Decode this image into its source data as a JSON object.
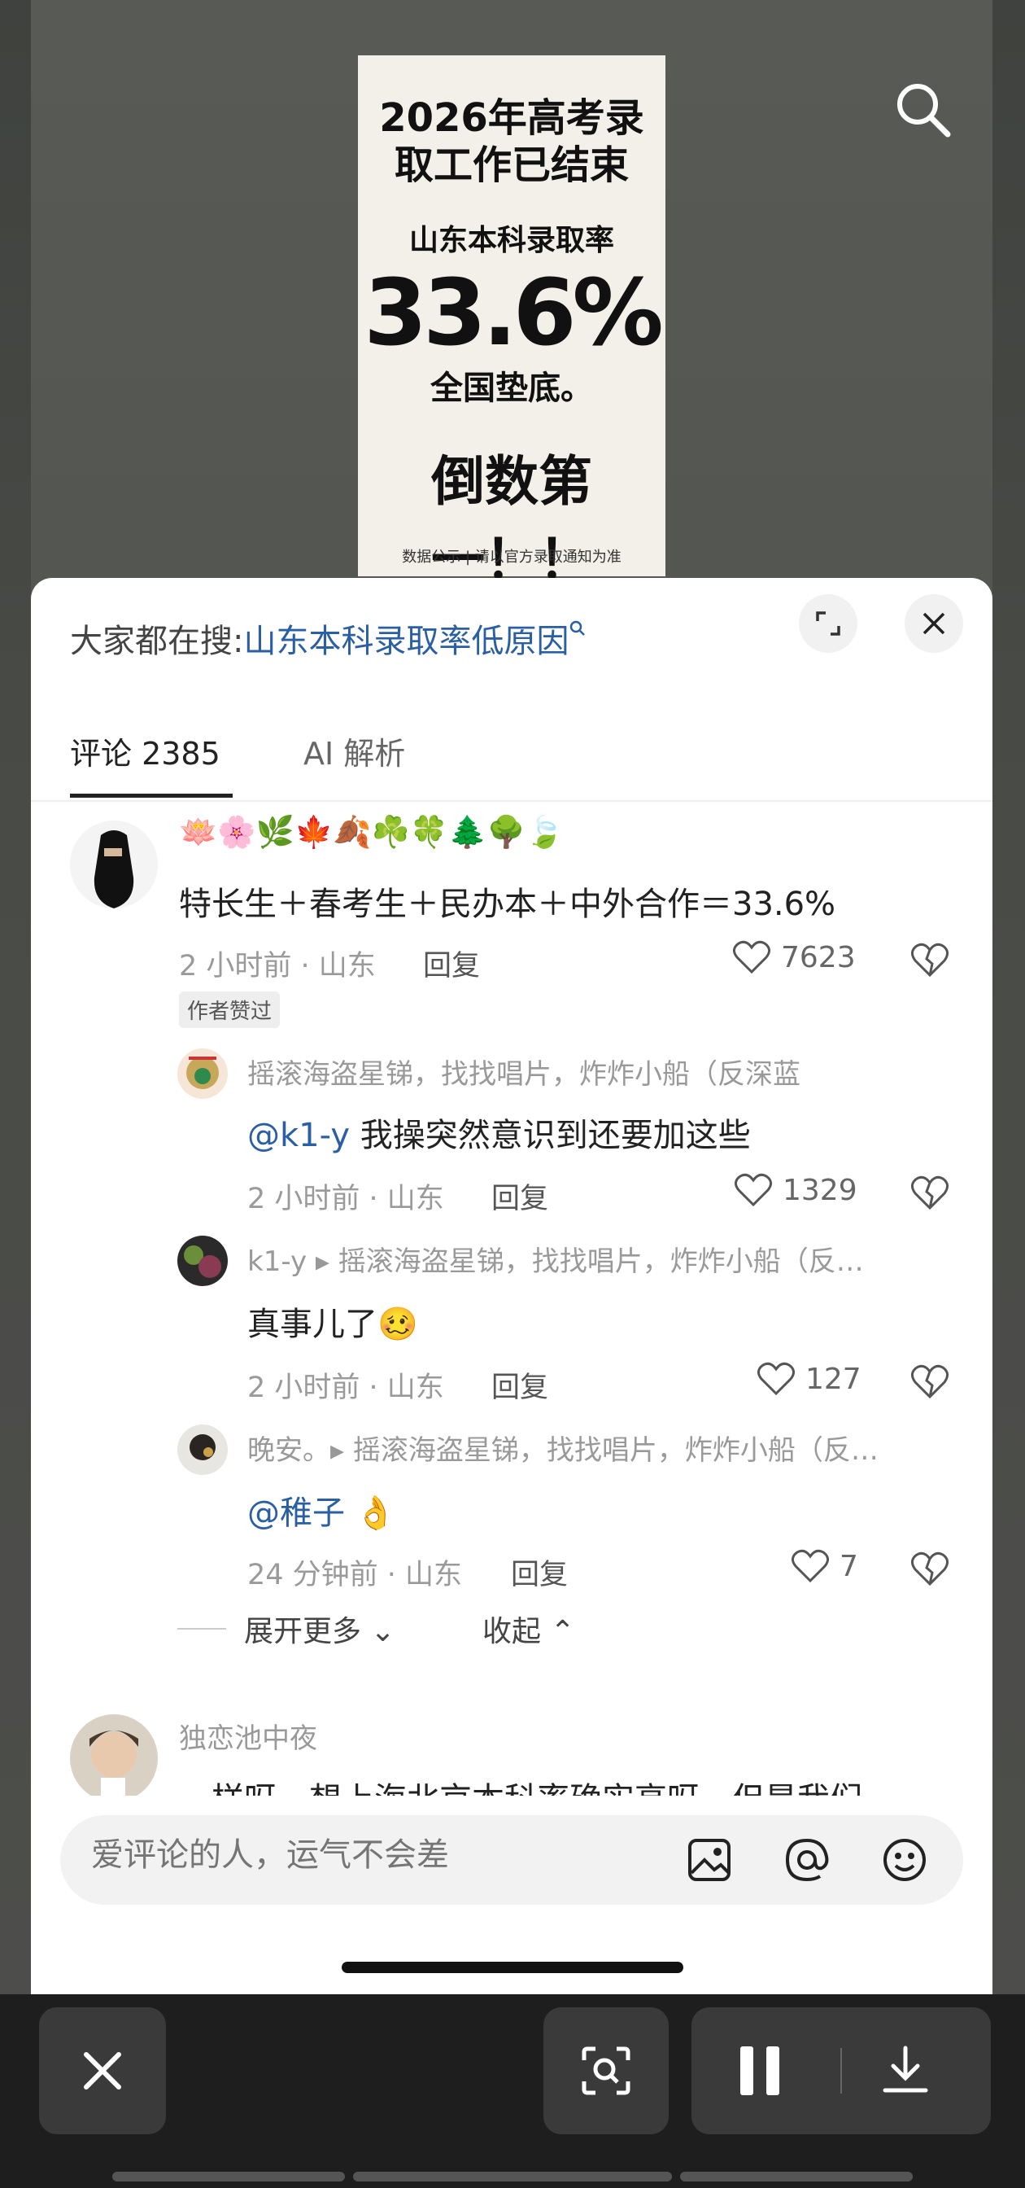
{
  "poster": {
    "line1": "2026年高考录取工作已结束",
    "line2": "山东本科录取率",
    "line3": "33.6%",
    "line4": "全国垫底。",
    "line5": "倒数第一！！",
    "footer": "数据公示 | 请以官方录取通知为准"
  },
  "sheet": {
    "hot_search_prefix": "大家都在搜:",
    "hot_search_link": "山东本科录取率低原因",
    "tabs": [
      {
        "label": "评论 2385",
        "active": true
      },
      {
        "label": "AI 解析",
        "active": false
      }
    ]
  },
  "comments": [
    {
      "name": "🪷🌸🌿🍁🍂☘️🍀🌲🌳🍃",
      "text": "特长生＋春考生＋民办本＋中外合作＝33.6%",
      "meta": "2 小时前 · 山东",
      "reply": "回复",
      "likes": "7623",
      "badge": "作者赞过"
    },
    {
      "name": "摇滚海盗星锑，找找唱片，炸炸小船（反深蓝",
      "text_at": "@k1-y",
      "text": " 我操突然意识到还要加这些",
      "meta": "2 小时前 · 山东",
      "reply": "回复",
      "likes": "1329"
    },
    {
      "name": "k1-y ▸ 摇滚海盗星锑，找找唱片，炸炸小船（反…",
      "text": "真事儿了🥴",
      "meta": "2 小时前 · 山东",
      "reply": "回复",
      "likes": "127"
    },
    {
      "name": "晚安。▸ 摇滚海盗星锑，找找唱片，炸炸小船（反…",
      "text_at": "@稚子",
      "text": " 👌",
      "meta": "24 分钟前 · 山东",
      "reply": "回复",
      "likes": "7"
    },
    {
      "name": "独恋池中夜",
      "text": "一样呀，想上海北京本科率确实高呀，但是我们"
    }
  ],
  "expand_more": "展开更多 ⌄",
  "collapse": "收起 ⌃",
  "input": {
    "placeholder": "爱评论的人，运气不会差"
  },
  "icons": [
    "search-icon",
    "expand-icon",
    "close-icon",
    "heart-icon",
    "dislike-icon",
    "image-icon",
    "at-icon",
    "emoji-icon",
    "pause-icon",
    "download-icon",
    "scan-icon"
  ]
}
